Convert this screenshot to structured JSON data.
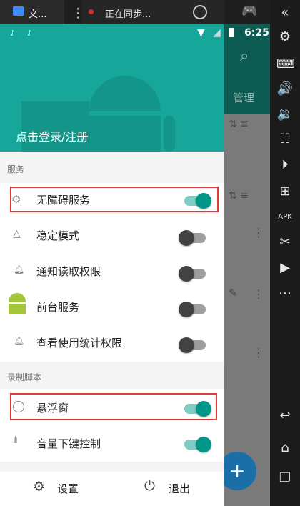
{
  "emulator": {
    "tab_title": "文...",
    "sync_title": "正在同步...",
    "toolbar_icons": [
      "collapse-icon",
      "settings-icon",
      "keyboard-icon",
      "volume-up-icon",
      "volume-down-icon",
      "screenshot-icon",
      "record-icon",
      "add-window-icon",
      "apk-icon",
      "scissors-icon",
      "video-icon",
      "more-icon",
      "back-icon",
      "home-icon",
      "recents-icon"
    ]
  },
  "status_bar": {
    "time": "6:25"
  },
  "background_app": {
    "tab_label": "管理"
  },
  "drawer": {
    "login_text": "点击登录/注册",
    "sections": [
      {
        "title": "服务",
        "items": [
          {
            "label": "无障碍服务",
            "icon": "gears-icon",
            "toggle": true
          },
          {
            "label": "稳定模式",
            "icon": "triangle-icon",
            "toggle": false
          },
          {
            "label": "通知读取权限",
            "icon": "bell-icon",
            "toggle": false
          },
          {
            "label": "前台服务",
            "icon": "android-icon",
            "toggle": false
          },
          {
            "label": "查看使用统计权限",
            "icon": "bell-icon",
            "toggle": false
          }
        ]
      },
      {
        "title": "录制脚本",
        "items": [
          {
            "label": "悬浮窗",
            "icon": "face-icon",
            "toggle": true
          },
          {
            "label": "音量下键控制",
            "icon": "soundwave-icon",
            "toggle": true
          }
        ]
      }
    ],
    "footer": {
      "settings": "设置",
      "exit": "退出"
    }
  },
  "fab": {
    "symbol": "+"
  },
  "colors": {
    "teal": "#16a69a",
    "accent": "#009688",
    "highlight": "#e53935"
  }
}
